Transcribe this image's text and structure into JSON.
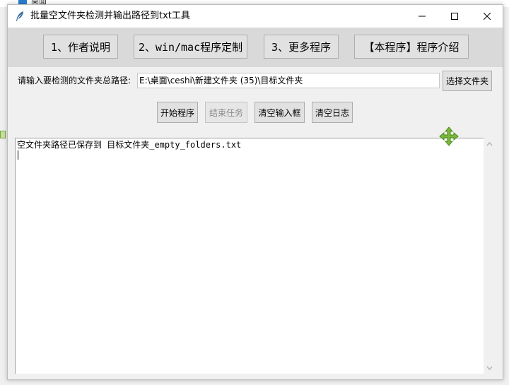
{
  "desktop": {
    "label": "桌面"
  },
  "window": {
    "title": "批量空文件夹检测并输出路径到txt工具",
    "controls": {
      "minimize": "—",
      "maximize": "☐",
      "close": "✕"
    }
  },
  "top_buttons": [
    {
      "label": "1、作者说明"
    },
    {
      "label": "2、win/mac程序定制"
    },
    {
      "label": "3、更多程序"
    },
    {
      "label": "【本程序】程序介绍"
    }
  ],
  "path": {
    "label": "请输入要检测的文件夹总路径:",
    "value": "E:\\桌面\\ceshi\\新建文件夹 (35)\\目标文件夹",
    "choose_button": "选择文件夹"
  },
  "actions": [
    {
      "label": "开始程序",
      "enabled": true
    },
    {
      "label": "结束任务",
      "enabled": false
    },
    {
      "label": "清空输入框",
      "enabled": true
    },
    {
      "label": "清空日志",
      "enabled": true
    }
  ],
  "log": {
    "lines": [
      "空文件夹路径已保存到 目标文件夹_empty_folders.txt"
    ]
  },
  "icons": {
    "app": "feather-icon",
    "cursor": "move-cursor-icon"
  },
  "colors": {
    "band": "#d9d9d9",
    "button": "#e1e1e1",
    "cursor_green": "#7ab83c"
  }
}
